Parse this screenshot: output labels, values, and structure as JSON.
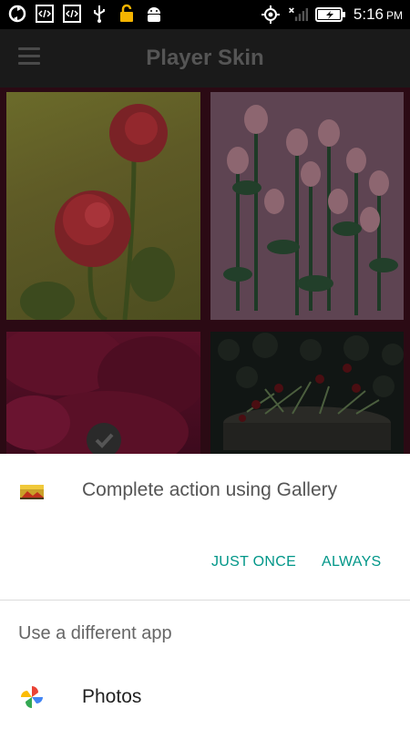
{
  "status_bar": {
    "time": "5:16",
    "ampm": "PM",
    "icons_left": [
      "sync-icon",
      "code-icon",
      "code-icon",
      "usb-icon",
      "lock-icon",
      "android-icon"
    ],
    "icons_right": [
      "gps-icon",
      "no-signal-icon",
      "battery-charging-icon"
    ]
  },
  "app_bar": {
    "title": "Player Skin",
    "menu_icon": "hamburger-menu-icon"
  },
  "grid": {
    "tiles": [
      "red-rose-image",
      "pink-roses-image",
      "red-petals-image",
      "flower-pot-image"
    ],
    "selected_icon": "checkmark-icon"
  },
  "sheet": {
    "title": "Complete action using Gallery",
    "just_once": "JUST ONCE",
    "always": "ALWAYS",
    "other_label": "Use a different app",
    "apps": [
      {
        "label": "Photos",
        "icon": "photos-pinwheel-icon"
      }
    ]
  },
  "colors": {
    "accent": "#009688",
    "appbar": "#1a1a1a",
    "statusbar": "#000000"
  }
}
